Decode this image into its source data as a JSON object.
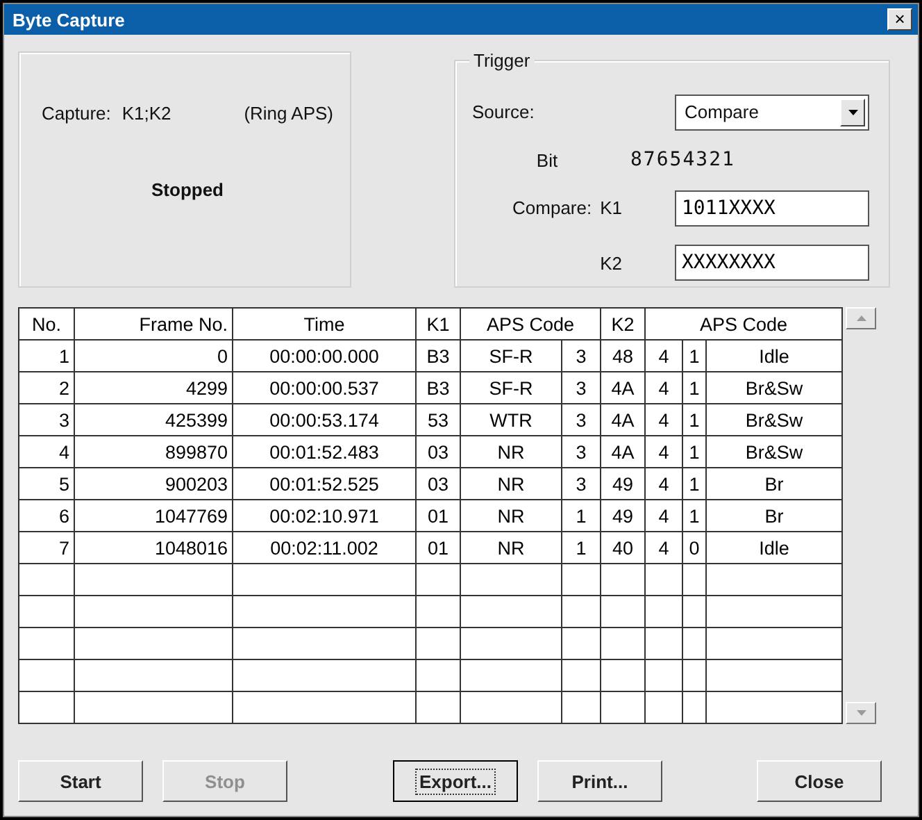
{
  "window": {
    "title": "Byte Capture",
    "close": "×"
  },
  "capture": {
    "label": "Capture:",
    "value": "K1;K2",
    "mode": "(Ring APS)",
    "status": "Stopped"
  },
  "trigger": {
    "title": "Trigger",
    "source_label": "Source:",
    "source_value": "Compare",
    "bit_label": "Bit",
    "bit_value": "87654321",
    "compare_label": "Compare:",
    "k1_label": "K1",
    "k1_value": "1011XXXX",
    "k2_label": "K2",
    "k2_value": "XXXXXXXX"
  },
  "table": {
    "columns": [
      "No.",
      "Frame No.",
      "Time",
      "K1",
      "APS Code",
      "K2",
      "APS Code"
    ],
    "rows": [
      [
        "1",
        "0",
        "00:00:00.000",
        "B3",
        [
          "SF-R",
          "3"
        ],
        "48",
        [
          "4",
          "1",
          "Idle"
        ]
      ],
      [
        "2",
        "4299",
        "00:00:00.537",
        "B3",
        [
          "SF-R",
          "3"
        ],
        "4A",
        [
          "4",
          "1",
          "Br&Sw"
        ]
      ],
      [
        "3",
        "425399",
        "00:00:53.174",
        "53",
        [
          "WTR",
          "3"
        ],
        "4A",
        [
          "4",
          "1",
          "Br&Sw"
        ]
      ],
      [
        "4",
        "899870",
        "00:01:52.483",
        "03",
        [
          "NR",
          "3"
        ],
        "4A",
        [
          "4",
          "1",
          "Br&Sw"
        ]
      ],
      [
        "5",
        "900203",
        "00:01:52.525",
        "03",
        [
          "NR",
          "3"
        ],
        "49",
        [
          "4",
          "1",
          "Br"
        ]
      ],
      [
        "6",
        "1047769",
        "00:02:10.971",
        "01",
        [
          "NR",
          "1"
        ],
        "49",
        [
          "4",
          "1",
          "Br"
        ]
      ],
      [
        "7",
        "1048016",
        "00:02:11.002",
        "01",
        [
          "NR",
          "1"
        ],
        "40",
        [
          "4",
          "0",
          "Idle"
        ]
      ]
    ]
  },
  "buttons": [
    {
      "label": "Start",
      "disabled": false,
      "focused": false
    },
    {
      "label": "Stop",
      "disabled": true,
      "focused": false
    },
    {
      "label": "Export...",
      "disabled": false,
      "focused": true
    },
    {
      "label": "Print...",
      "disabled": false,
      "focused": false
    },
    {
      "label": "Close",
      "disabled": false,
      "focused": false
    }
  ]
}
